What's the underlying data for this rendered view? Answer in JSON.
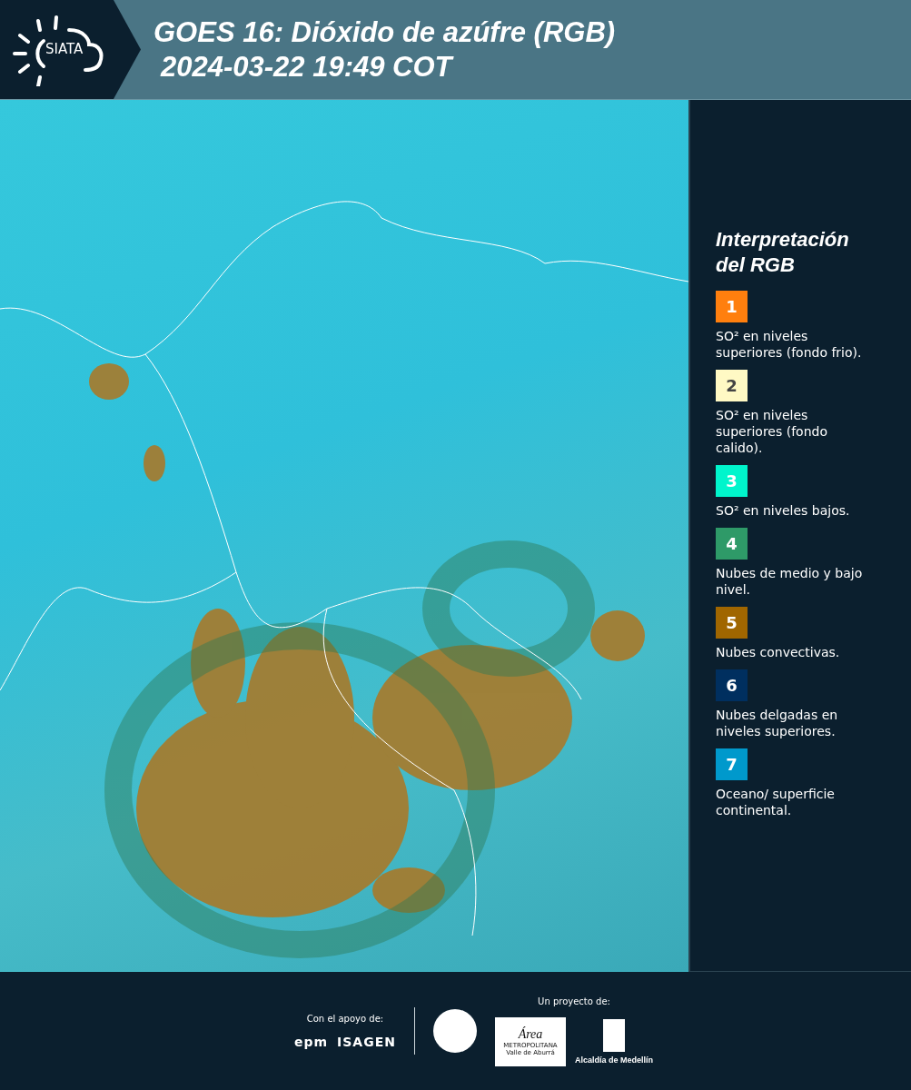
{
  "header": {
    "logo_text": "SIATA",
    "title_line_1": "GOES 16: Dióxido de azúfre (RGB)",
    "title_line_2": "2024-03-22 19:49 COT"
  },
  "legend": {
    "title": "Interpretación del RGB",
    "items": [
      {
        "number": "1",
        "color": "#ff7f0e",
        "label": "SO² en niveles superiores (fondo frio)."
      },
      {
        "number": "2",
        "color": "#fff9c4",
        "label": "SO² en niveles superiores (fondo calido)."
      },
      {
        "number": "3",
        "color": "#00f5cc",
        "label": "SO² en niveles bajos."
      },
      {
        "number": "4",
        "color": "#2e9a68",
        "label": "Nubes de medio y bajo nivel."
      },
      {
        "number": "5",
        "color": "#a06600",
        "label": "Nubes convectivas."
      },
      {
        "number": "6",
        "color": "#002f5f",
        "label": "Nubes delgadas en niveles superiores."
      },
      {
        "number": "7",
        "color": "#0099cc",
        "label": "Oceano/ superficie continental."
      }
    ]
  },
  "footer": {
    "support_label": "Con el apoyo de:",
    "support_logos": [
      "epm",
      "ISAGEN"
    ],
    "project_label": "Un proyecto de:",
    "area_logo": {
      "name": "Área",
      "line_1": "METROPOLITANA",
      "line_2": "Valle de Aburrá"
    },
    "alcaldia": "Alcaldía de Medellín"
  }
}
